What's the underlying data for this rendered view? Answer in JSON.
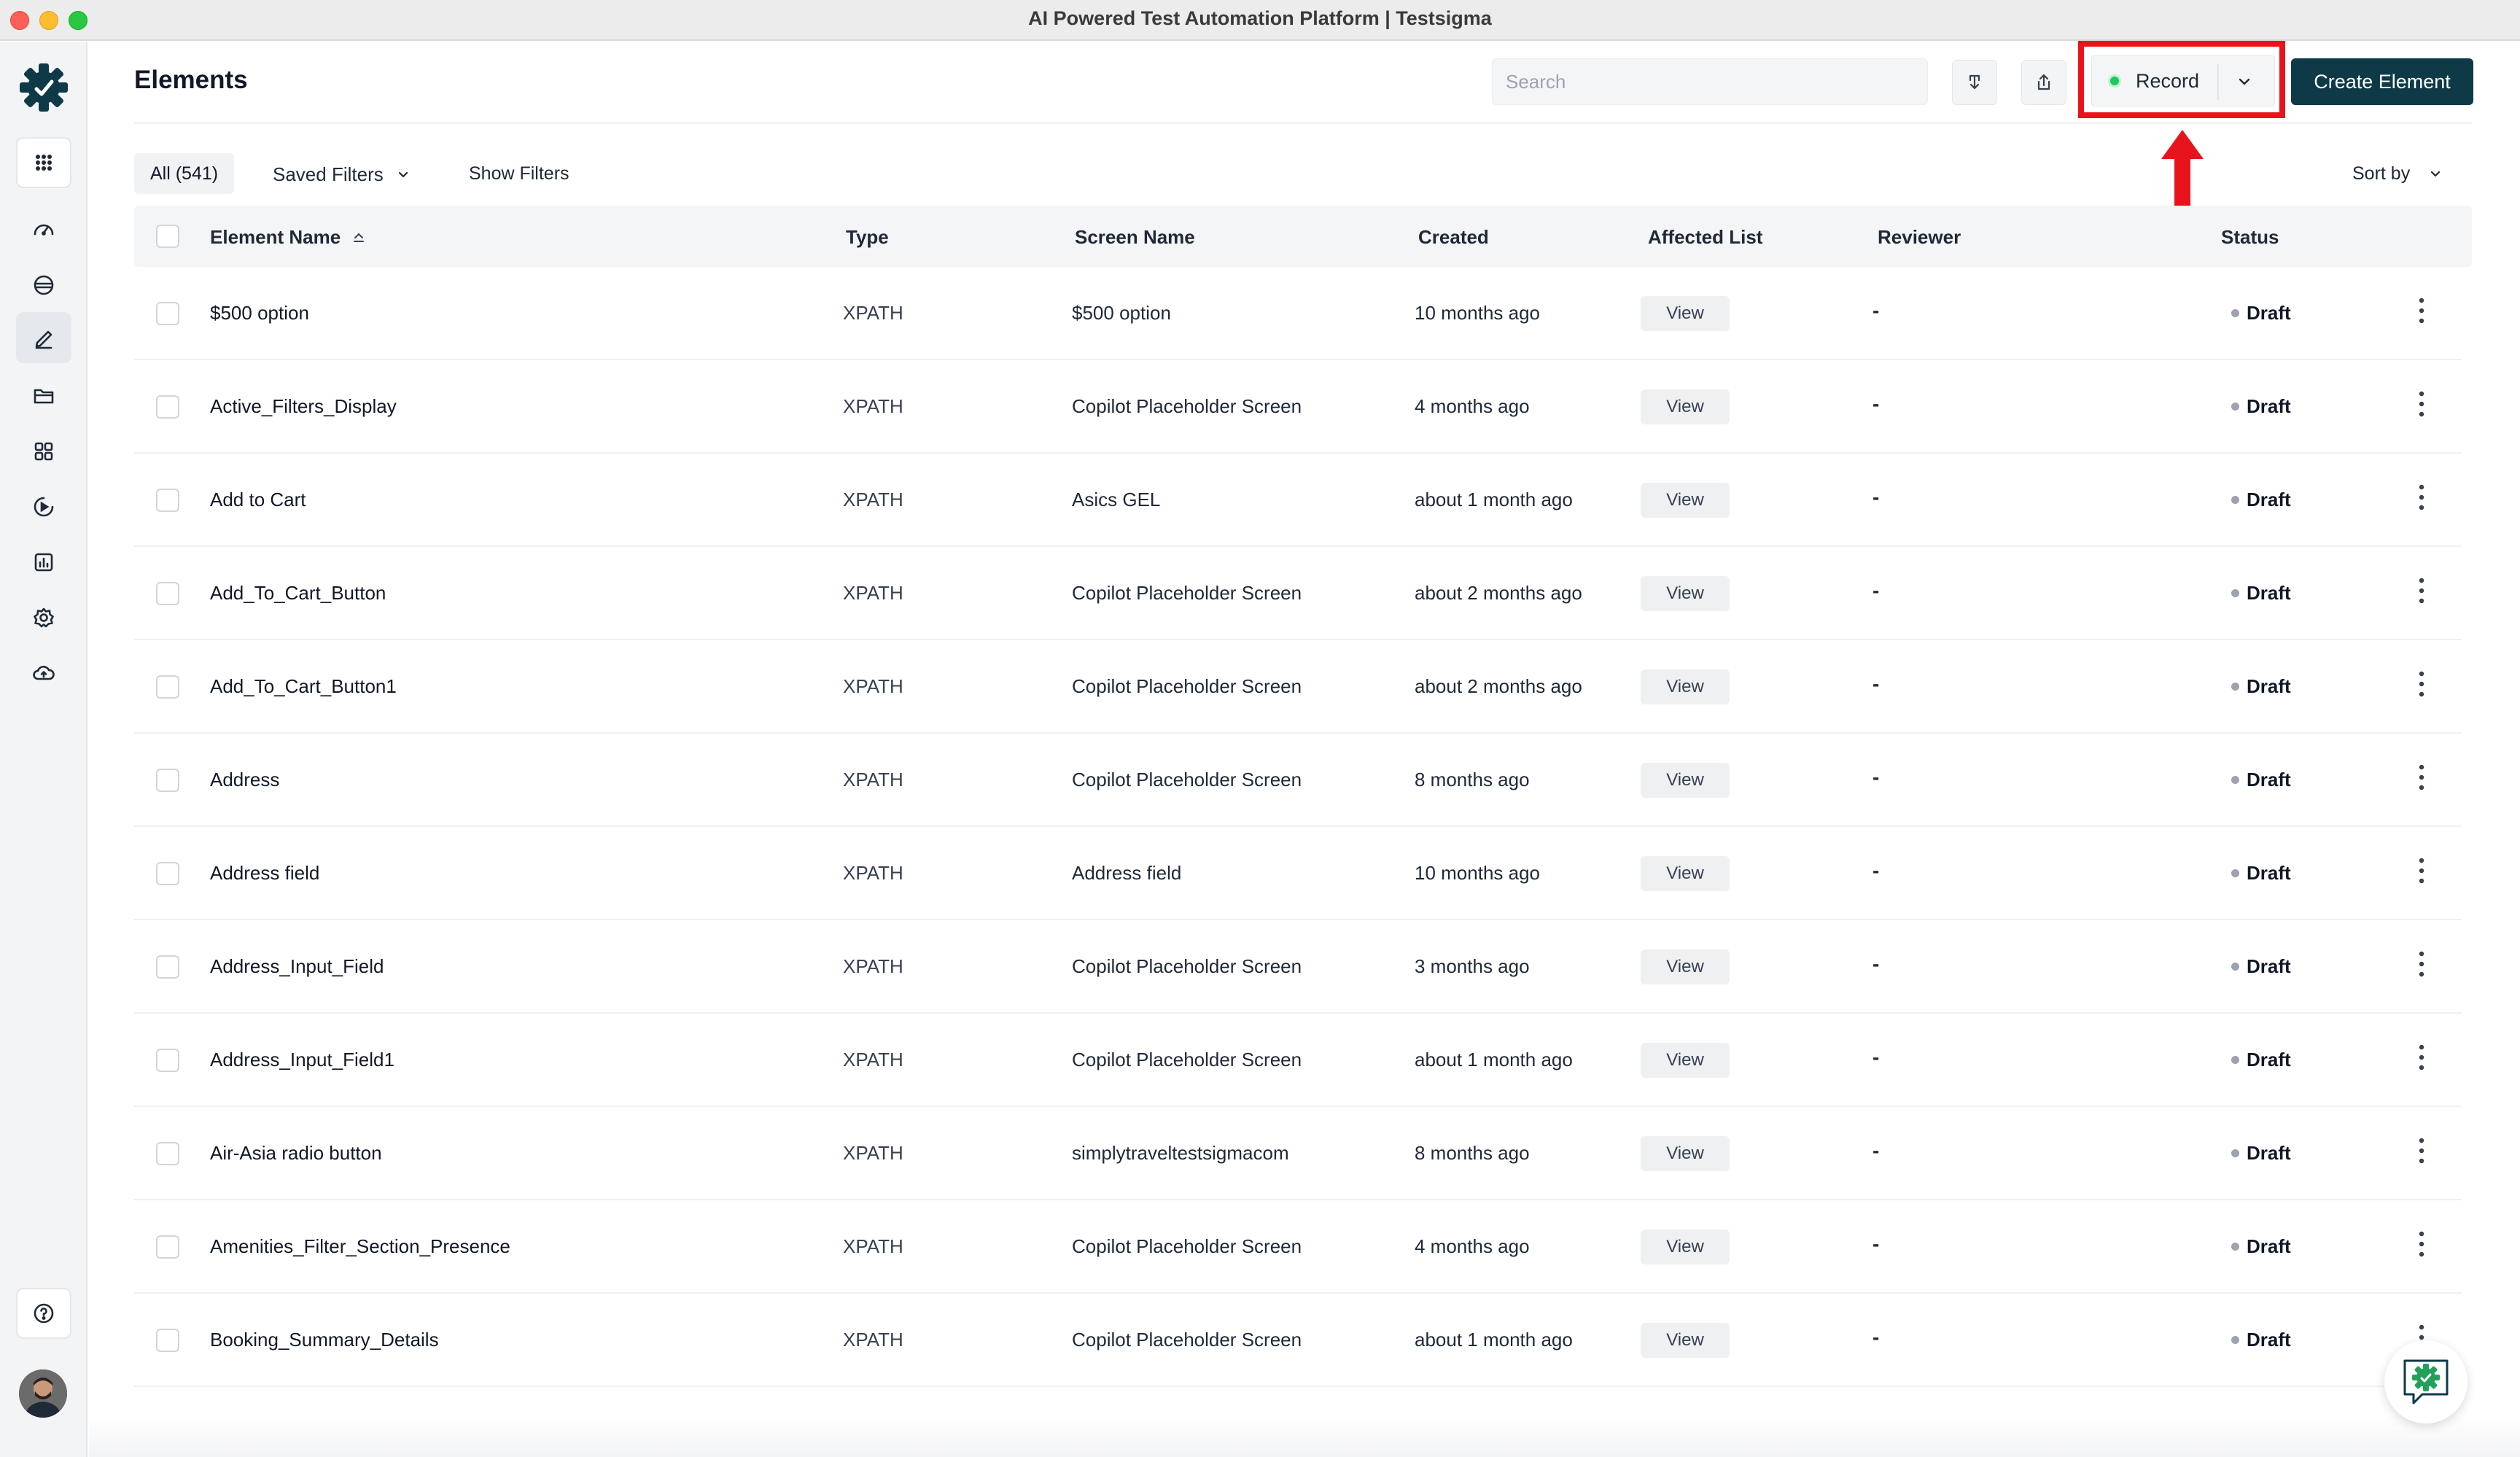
{
  "window": {
    "title": "AI Powered Test Automation Platform | Testsigma"
  },
  "sidebar": {
    "items": [
      {
        "name": "apps-grid-icon"
      },
      {
        "name": "dashboard-icon"
      },
      {
        "name": "test-suites-icon"
      },
      {
        "name": "elements-icon",
        "active": true
      },
      {
        "name": "folder-icon"
      },
      {
        "name": "add-ons-icon"
      },
      {
        "name": "run-icon"
      },
      {
        "name": "reports-icon"
      },
      {
        "name": "settings-icon"
      },
      {
        "name": "cloud-upload-icon"
      }
    ],
    "help_icon": "help-icon"
  },
  "header": {
    "title": "Elements",
    "search_placeholder": "Search",
    "record_label": "Record",
    "create_label": "Create Element",
    "accent_color": "#0e3a47",
    "highlight_color": "#e8141c"
  },
  "filters": {
    "all_label": "All (541)",
    "saved_filters_label": "Saved Filters",
    "show_filters_label": "Show Filters",
    "sort_by_label": "Sort by"
  },
  "table": {
    "columns": [
      "Element Name",
      "Type",
      "Screen Name",
      "Created",
      "Affected List",
      "Reviewer",
      "Status"
    ],
    "view_label": "View",
    "rows": [
      {
        "name": "$500 option",
        "type": "XPATH",
        "screen": "$500 option",
        "created": "10 months ago",
        "reviewer": "-",
        "status": "Draft"
      },
      {
        "name": "Active_Filters_Display",
        "type": "XPATH",
        "screen": "Copilot Placeholder Screen",
        "created": "4 months ago",
        "reviewer": "-",
        "status": "Draft"
      },
      {
        "name": "Add to Cart",
        "type": "XPATH",
        "screen": "Asics GEL",
        "created": "about 1 month ago",
        "reviewer": "-",
        "status": "Draft"
      },
      {
        "name": "Add_To_Cart_Button",
        "type": "XPATH",
        "screen": "Copilot Placeholder Screen",
        "created": "about 2 months ago",
        "reviewer": "-",
        "status": "Draft"
      },
      {
        "name": "Add_To_Cart_Button1",
        "type": "XPATH",
        "screen": "Copilot Placeholder Screen",
        "created": "about 2 months ago",
        "reviewer": "-",
        "status": "Draft"
      },
      {
        "name": "Address",
        "type": "XPATH",
        "screen": "Copilot Placeholder Screen",
        "created": "8 months ago",
        "reviewer": "-",
        "status": "Draft"
      },
      {
        "name": "Address field",
        "type": "XPATH",
        "screen": "Address field",
        "created": "10 months ago",
        "reviewer": "-",
        "status": "Draft"
      },
      {
        "name": "Address_Input_Field",
        "type": "XPATH",
        "screen": "Copilot Placeholder Screen",
        "created": "3 months ago",
        "reviewer": "-",
        "status": "Draft"
      },
      {
        "name": "Address_Input_Field1",
        "type": "XPATH",
        "screen": "Copilot Placeholder Screen",
        "created": "about 1 month ago",
        "reviewer": "-",
        "status": "Draft"
      },
      {
        "name": "Air-Asia radio button",
        "type": "XPATH",
        "screen": "simplytraveltestsigmacom",
        "created": "8 months ago",
        "reviewer": "-",
        "status": "Draft"
      },
      {
        "name": "Amenities_Filter_Section_Presence",
        "type": "XPATH",
        "screen": "Copilot Placeholder Screen",
        "created": "4 months ago",
        "reviewer": "-",
        "status": "Draft"
      },
      {
        "name": "Booking_Summary_Details",
        "type": "XPATH",
        "screen": "Copilot Placeholder Screen",
        "created": "about 1 month ago",
        "reviewer": "-",
        "status": "Draft"
      }
    ]
  }
}
